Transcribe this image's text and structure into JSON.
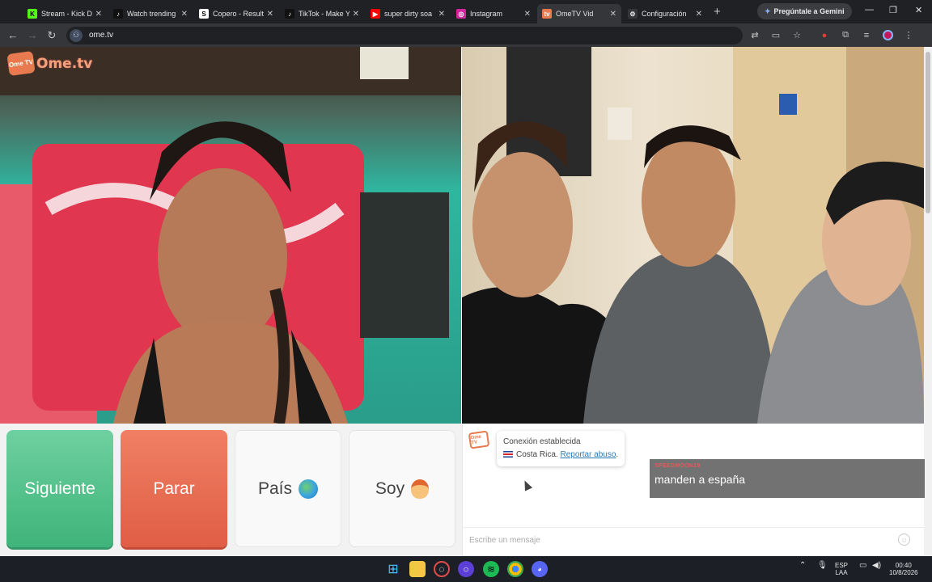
{
  "browser": {
    "tabs": [
      {
        "title": "Stream - Kick D",
        "favicon": "K",
        "color": "#53fc18",
        "text": "#000"
      },
      {
        "title": "Watch trending",
        "favicon": "♪",
        "color": "#111111",
        "text": "#fff"
      },
      {
        "title": "Copero - Result",
        "favicon": "S",
        "color": "#ffffff",
        "text": "#000"
      },
      {
        "title": "TikTok - Make Y",
        "favicon": "♪",
        "color": "#111111",
        "text": "#fff"
      },
      {
        "title": "super dirty soa",
        "favicon": "▶",
        "color": "#ff0000",
        "text": "#fff"
      },
      {
        "title": "Instagram",
        "favicon": "◎",
        "color": "#d6249f",
        "text": "#fff"
      },
      {
        "title": "OmeTV Vid",
        "favicon": "tv",
        "color": "#e87a4f",
        "text": "#fff"
      },
      {
        "title": "Configuración",
        "favicon": "⚙",
        "color": "#35363a",
        "text": "#e3e3e3"
      }
    ],
    "active_tab": 6,
    "gemini_label": "Pregúntale a Gemini",
    "url": "ome.tv"
  },
  "page": {
    "logo_badge": "Ome TV",
    "logo_text": "Ome.tv",
    "buttons": {
      "next": "Siguiente",
      "stop": "Parar",
      "country": "País",
      "gender": "Soy"
    },
    "chat": {
      "avatar": "Ome TV",
      "status": "Conexión establecida",
      "country": "Costa Rica.",
      "report": "Reportar abuso",
      "report_suffix": ".",
      "input_placeholder": "Escribe un mensaje"
    },
    "overlay": {
      "username": "SPEEDMOON19",
      "message": "manden a españa"
    }
  },
  "taskbar": {
    "lang_top": "ESP",
    "lang_bottom": "LAA",
    "time": "00:40",
    "date": "10/8/2026"
  }
}
